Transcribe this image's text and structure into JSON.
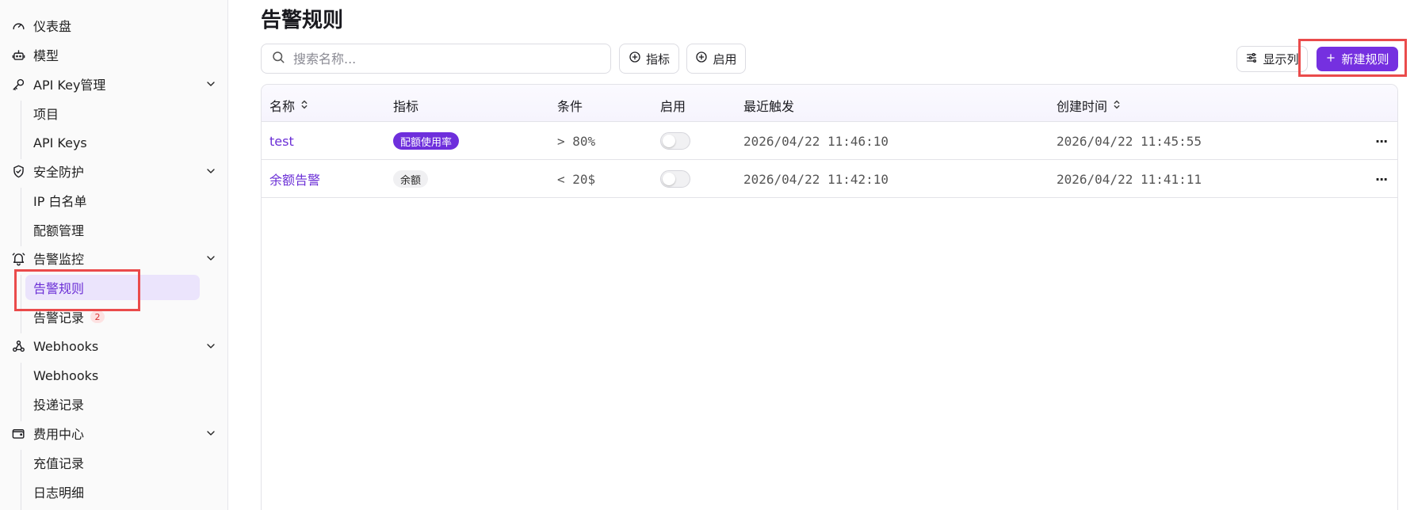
{
  "sidebar": {
    "items": [
      {
        "label": "仪表盘",
        "icon": "gauge-icon"
      },
      {
        "label": "模型",
        "icon": "robot-icon"
      },
      {
        "label": "API Key管理",
        "icon": "key-icon"
      },
      {
        "label": "项目"
      },
      {
        "label": "API Keys"
      },
      {
        "label": "安全防护",
        "icon": "shield-check-icon"
      },
      {
        "label": "IP 白名单"
      },
      {
        "label": "配额管理"
      },
      {
        "label": "告警监控",
        "icon": "bell-icon"
      },
      {
        "label": "告警规则"
      },
      {
        "label": "告警记录",
        "badge": "2"
      },
      {
        "label": "Webhooks",
        "icon": "webhook-icon"
      },
      {
        "label": "Webhooks"
      },
      {
        "label": "投递记录"
      },
      {
        "label": "费用中心",
        "icon": "wallet-icon"
      },
      {
        "label": "充值记录"
      },
      {
        "label": "日志明细"
      }
    ]
  },
  "page": {
    "title": "告警规则"
  },
  "toolbar": {
    "search_placeholder": "搜索名称...",
    "filter_metric": "指标",
    "filter_enabled": "启用",
    "columns_button": "显示列",
    "new_rule_button": "新建规则"
  },
  "table": {
    "headers": [
      "名称",
      "指标",
      "条件",
      "启用",
      "最近触发",
      "创建时间"
    ],
    "rows": [
      {
        "name": "test",
        "metric": "配额使用率",
        "metric_style": "purple",
        "condition": "> 80%",
        "enabled": false,
        "last_triggered": "2026/04/22 11:46:10",
        "created": "2026/04/22 11:45:55"
      },
      {
        "name": "余额告警",
        "metric": "余额",
        "metric_style": "gray",
        "condition": "< 20$",
        "enabled": false,
        "last_triggered": "2026/04/22 11:42:10",
        "created": "2026/04/22 11:41:11"
      }
    ]
  },
  "colors": {
    "accent": "#7530e0",
    "highlight_box": "#ea4b4b",
    "active_bg": "#ebe4fc"
  }
}
